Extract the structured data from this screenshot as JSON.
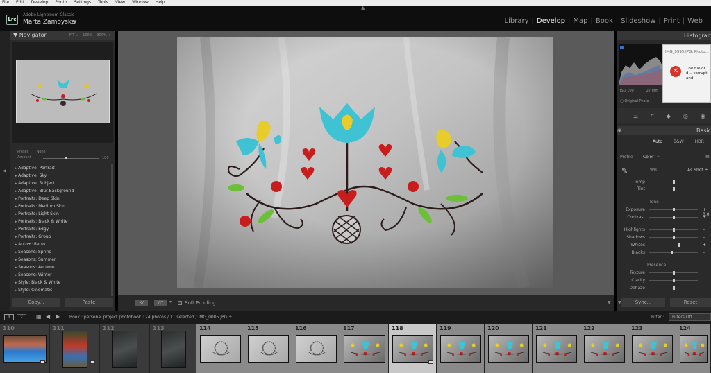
{
  "menu": [
    "File",
    "Edit",
    "Develop",
    "Photo",
    "Settings",
    "Tools",
    "View",
    "Window",
    "Help"
  ],
  "identity": {
    "app_name": "Adobe Lightroom Classic",
    "user_name": "Marta Zamoyska",
    "logo": "Lrc"
  },
  "modules": [
    {
      "label": "Library",
      "active": false
    },
    {
      "label": "Develop",
      "active": true
    },
    {
      "label": "Map",
      "active": false
    },
    {
      "label": "Book",
      "active": false
    },
    {
      "label": "Slideshow",
      "active": false
    },
    {
      "label": "Print",
      "active": false
    },
    {
      "label": "Web",
      "active": false
    }
  ],
  "navigator": {
    "title": "Navigator",
    "zoom_options": [
      "FIT ÷",
      "100%",
      "300% ÷"
    ]
  },
  "presets": {
    "preset_label": "Preset",
    "preset_value": "None",
    "amount_label": "Amount",
    "amount_value": "100",
    "items": [
      "Adaptive: Portrait",
      "Adaptive: Sky",
      "Adaptive: Subject",
      "Adaptive: Blur Background",
      "Portraits: Deep Skin",
      "Portraits: Medium Skin",
      "Portraits: Light Skin",
      "Portraits: Black & White",
      "Portraits: Edgy",
      "Portraits: Group",
      "Auto+: Retro",
      "Seasons: Spring",
      "Seasons: Summer",
      "Seasons: Autumn",
      "Seasons: Winter",
      "Style: Black & White",
      "Style: Cinematic"
    ]
  },
  "left_buttons": {
    "copy": "Copy...",
    "paste": "Paste"
  },
  "toolbar": {
    "soft_proofing": "Soft Proofing",
    "compare": "XY",
    "survey": "Y|Y"
  },
  "histogram": {
    "title": "Histogram",
    "iso": "ISO 100",
    "focal": "27 mm",
    "original_photo": "Original Photo"
  },
  "error_dialog": {
    "title": "IMG_9995.JPG: Photo...",
    "message": "The file or d... corrupt and"
  },
  "basic": {
    "title": "Basic",
    "treatment": [
      "Auto",
      "B&W",
      "HDR"
    ],
    "profile_label": "Profile",
    "profile_value": "Color",
    "wb_label": "WB",
    "wb_value": "As Shot ÷",
    "tone_title": "Tone",
    "presence_title": "Presence",
    "sliders": [
      {
        "label": "Temp",
        "value": "",
        "level": 0.5,
        "track": "#3b5aa0,#b8a23a"
      },
      {
        "label": "Tint",
        "value": "",
        "level": 0.5,
        "track": "#3a9a3a,#a03aa0"
      },
      {
        "label": "Exposure",
        "value": "+ 0.0",
        "level": 0.5,
        "track": "#555,#555"
      },
      {
        "label": "Contrast",
        "value": "+",
        "level": 0.5,
        "track": "#555,#555"
      },
      {
        "label": "Highlights",
        "value": "–",
        "level": 0.5,
        "track": "#555,#555"
      },
      {
        "label": "Shadows",
        "value": "–",
        "level": 0.5,
        "track": "#555,#555"
      },
      {
        "label": "Whites",
        "value": "+",
        "level": 0.6,
        "track": "#555,#555"
      },
      {
        "label": "Blacks",
        "value": "–",
        "level": 0.45,
        "track": "#555,#555"
      },
      {
        "label": "Texture",
        "value": "",
        "level": 0.5,
        "track": "#555,#555"
      },
      {
        "label": "Clarity",
        "value": "",
        "level": 0.5,
        "track": "#555,#555"
      },
      {
        "label": "Dehaze",
        "value": "",
        "level": 0.5,
        "track": "#555,#555"
      }
    ]
  },
  "right_buttons": {
    "sync": "Sync...",
    "reset": "Reset"
  },
  "filmbar": {
    "monitor1": "1",
    "monitor2": "2",
    "source": "Book : personal project photobook    124 photos / 11 selected / IMG_0005.JPG ÷",
    "filter_label": "Filter :",
    "filter_value": "Filters Off"
  },
  "filmstrip": [
    {
      "num": "110",
      "kind": "pool",
      "state": "dim"
    },
    {
      "num": "111",
      "kind": "playground",
      "state": "dim"
    },
    {
      "num": "112",
      "kind": "dark",
      "state": "dim"
    },
    {
      "num": "113",
      "kind": "dark",
      "state": "dim"
    },
    {
      "num": "114",
      "kind": "gray",
      "state": "sel"
    },
    {
      "num": "115",
      "kind": "gray",
      "state": "sel"
    },
    {
      "num": "116",
      "kind": "gray",
      "state": "sel"
    },
    {
      "num": "117",
      "kind": "color",
      "state": "sel"
    },
    {
      "num": "118",
      "kind": "color",
      "state": "cur"
    },
    {
      "num": "119",
      "kind": "color",
      "state": "sel"
    },
    {
      "num": "120",
      "kind": "color",
      "state": "sel"
    },
    {
      "num": "121",
      "kind": "color",
      "state": "sel"
    },
    {
      "num": "122",
      "kind": "color",
      "state": "sel"
    },
    {
      "num": "123",
      "kind": "color",
      "state": "sel"
    },
    {
      "num": "124",
      "kind": "color",
      "state": "sel"
    }
  ]
}
